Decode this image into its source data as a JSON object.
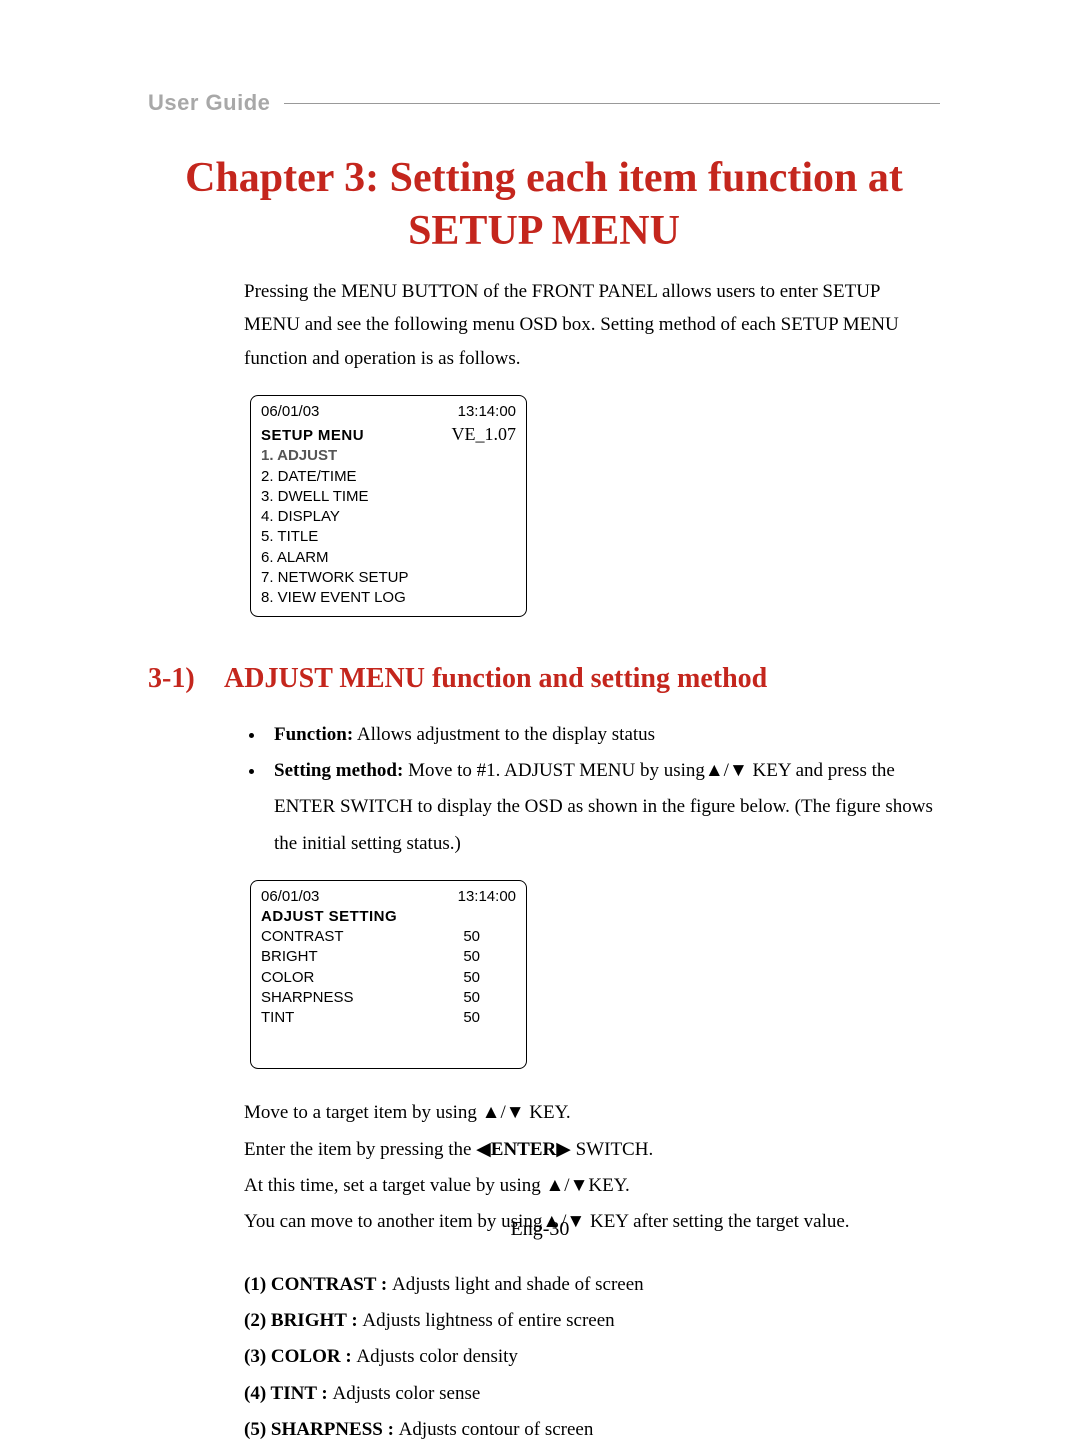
{
  "header": {
    "label": "User Guide"
  },
  "chapter": {
    "title": "Chapter 3:  Setting each item function at SETUP MENU"
  },
  "intro": "Pressing the MENU BUTTON of the FRONT PANEL allows users to enter SETUP MENU and see the following menu OSD box. Setting method of each SETUP MENU function and operation is as follows.",
  "osd1": {
    "date": "06/01/03",
    "time": "13:14:00",
    "header": "SETUP       MENU",
    "version": "VE_1.07",
    "items": [
      "1. ADJUST",
      "2. DATE/TIME",
      "3. DWELL TIME",
      "4. DISPLAY",
      "5. TITLE",
      "6. ALARM",
      "7. NETWORK SETUP",
      "8. VIEW EVENT LOG"
    ]
  },
  "section": {
    "num": "3-1)",
    "title": "ADJUST MENU function and setting method"
  },
  "bullets": {
    "b1_label": "Function:",
    "b1_text": " Allows adjustment to the display status",
    "b2_label": "Setting method:",
    "b2_text": " Move to #1. ADJUST MENU by using▲/▼ KEY and press the ENTER SWITCH to display the OSD as shown in the figure below. (The figure shows the initial setting status.)"
  },
  "osd2": {
    "date": "06/01/03",
    "time": "13:14:00",
    "header": "ADJUST     SETTING",
    "rows": [
      {
        "label": "CONTRAST",
        "value": "50"
      },
      {
        "label": "BRIGHT",
        "value": "50"
      },
      {
        "label": "COLOR",
        "value": "50"
      },
      {
        "label": "SHARPNESS",
        "value": "50"
      },
      {
        "label": "TINT",
        "value": "50"
      }
    ]
  },
  "instructions": {
    "l1": "Move to a target item by using ▲/▼ KEY.",
    "l2_pre": "Enter the item by pressing the ◀",
    "l2_bold": "ENTER",
    "l2_post": "▶ SWITCH.",
    "l3": "At this time, set a target value by using ▲/▼KEY.",
    "l4": "You can move to another item by using▲/▼ KEY after setting the target value."
  },
  "defs": {
    "d1_label": "(1) CONTRAST : ",
    "d1_text": "Adjusts light and shade of screen",
    "d2_label": "(2) BRIGHT : ",
    "d2_text": "Adjusts lightness of entire screen",
    "d3_label": "(3) COLOR : ",
    "d3_text": "Adjusts color density",
    "d4_label": "(4) TINT : ",
    "d4_text": "Adjusts color sense",
    "d5_label": "(5) SHARPNESS : ",
    "d5_text": "Adjusts contour of screen"
  },
  "pagenum": "Eng-30"
}
